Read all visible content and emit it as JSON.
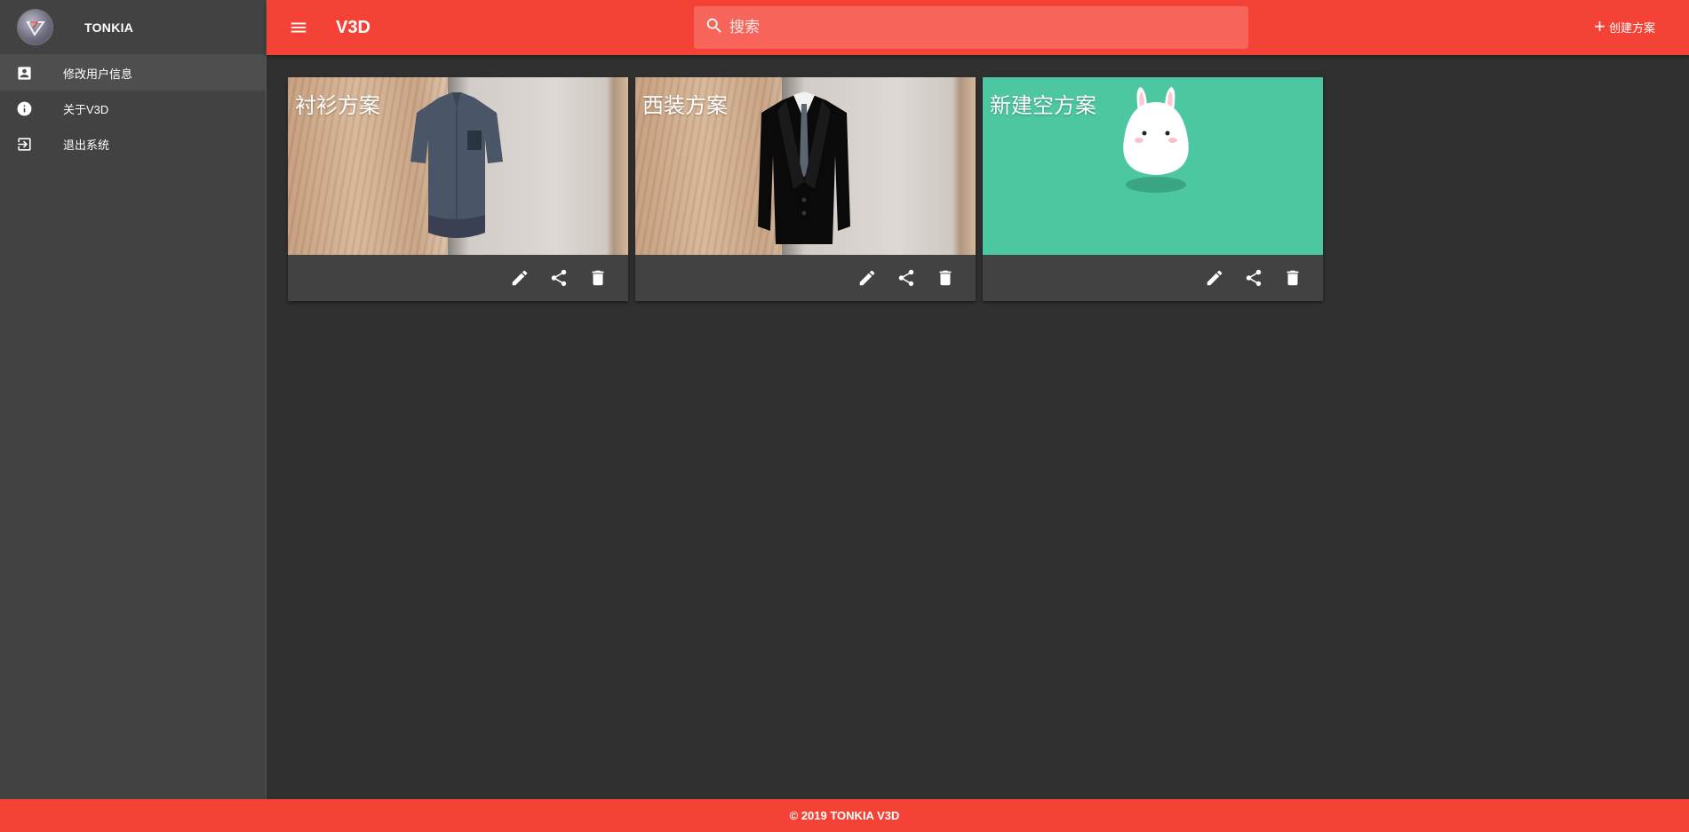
{
  "sidebar": {
    "username": "TONKIA",
    "items": [
      {
        "label": "修改用户信息",
        "icon": "account-box-icon"
      },
      {
        "label": "关于V3D",
        "icon": "info-icon"
      },
      {
        "label": "退出系统",
        "icon": "exit-icon"
      }
    ]
  },
  "topbar": {
    "title": "V3D",
    "search_placeholder": "搜索",
    "create_label": "创建方案"
  },
  "cards": [
    {
      "title": "衬衫方案",
      "image": "shirt"
    },
    {
      "title": "西装方案",
      "image": "suit"
    },
    {
      "title": "新建空方案",
      "image": "bunny"
    }
  ],
  "card_actions": [
    "edit-icon",
    "share-icon",
    "delete-icon"
  ],
  "colors": {
    "primary": "#f44336",
    "background": "#303030",
    "sidebar": "#424242",
    "empty_card": "#4dc7a2"
  },
  "footer": {
    "text": "© 2019 TONKIA V3D"
  }
}
